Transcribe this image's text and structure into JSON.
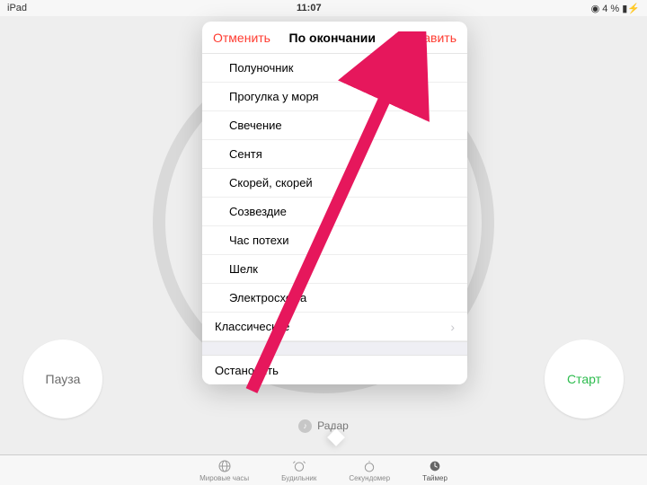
{
  "status": {
    "left": "iPad",
    "center": "11:07",
    "right": "◉ 4 % ▮⚡"
  },
  "controls": {
    "pause": "Пауза",
    "start": "Старт"
  },
  "soundRow": {
    "icon": "note-icon",
    "label": "Радар"
  },
  "tabs": [
    "Мировые часы",
    "Будильник",
    "Секундомер",
    "Таймер"
  ],
  "popover": {
    "cancel": "Отменить",
    "title": "По окончании",
    "set": "Выставить",
    "sounds": [
      "Полуночник",
      "Прогулка у моря",
      "Свечение",
      "Сентя",
      "Скорей, скорей",
      "Созвездие",
      "Час потехи",
      "Шелк",
      "Электросхема"
    ],
    "groupRow": "Классические",
    "stop": "Остановить"
  }
}
